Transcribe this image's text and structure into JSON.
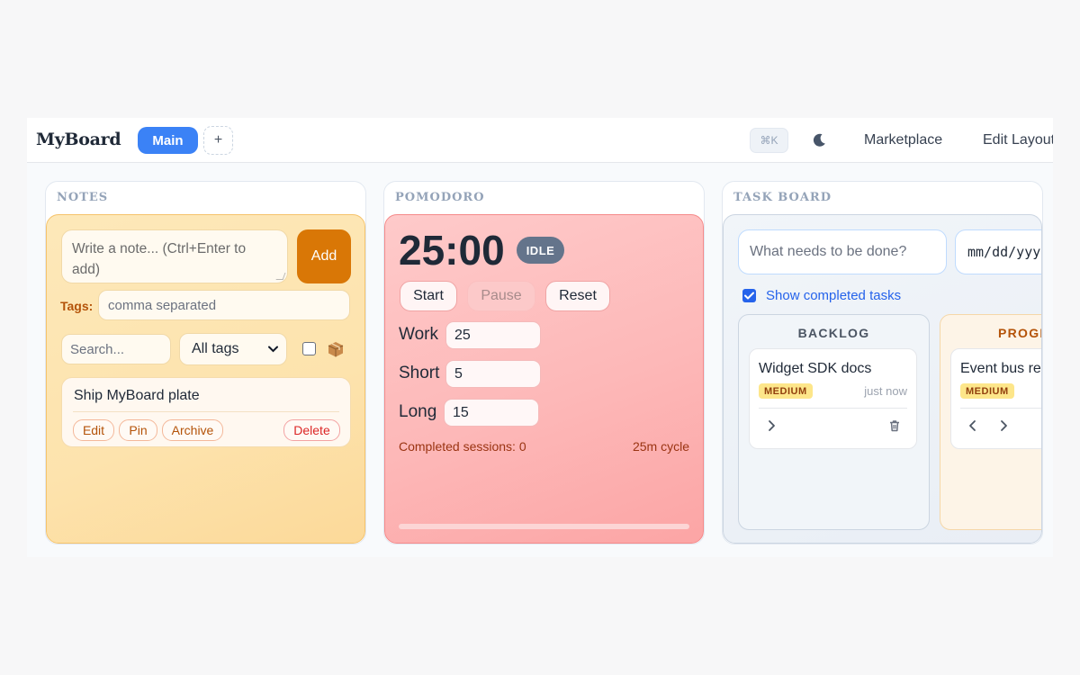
{
  "header": {
    "brand": "MyBoard",
    "tabs": [
      {
        "label": "Main",
        "active": true
      }
    ],
    "add_tab_label": "+",
    "shortcut_hint": "⌘K",
    "nav": {
      "marketplace": "Marketplace",
      "edit_layout": "Edit Layout"
    }
  },
  "notes": {
    "title": "NOTES",
    "note_placeholder": "Write a note... (Ctrl+Enter to add)",
    "add_label": "Add",
    "tags_label": "Tags:",
    "tags_placeholder": "comma separated",
    "search_placeholder": "Search...",
    "tag_filter_selected": "All tags",
    "archive_toggle_checked": false,
    "items": [
      {
        "title": "Ship MyBoard plate",
        "actions": {
          "edit": "Edit",
          "pin": "Pin",
          "archive": "Archive",
          "delete": "Delete"
        }
      }
    ]
  },
  "pomodoro": {
    "title": "POMODORO",
    "time": "25:00",
    "status": "IDLE",
    "buttons": {
      "start": "Start",
      "pause": "Pause",
      "reset": "Reset"
    },
    "work_label": "Work",
    "work_value": "25",
    "short_label": "Short",
    "short_value": "5",
    "long_label": "Long",
    "long_value": "15",
    "sessions_text": "Completed sessions: 0",
    "cycle_text": "25m cycle",
    "progress": 0
  },
  "taskboard": {
    "title": "TASK BOARD",
    "task_placeholder": "What needs to be done?",
    "date_placeholder": "mm/dd/yyyy",
    "show_completed_label": "Show completed tasks",
    "show_completed_checked": true,
    "columns": [
      {
        "title": "BACKLOG",
        "cards": [
          {
            "title": "Widget SDK docs",
            "priority": "MEDIUM",
            "time": "just now"
          }
        ]
      },
      {
        "title": "PROGRESS",
        "cards": [
          {
            "title": "Event bus refactor",
            "priority": "MEDIUM",
            "time": ""
          }
        ]
      }
    ]
  },
  "colors": {
    "accent": "#3b82f6",
    "notes_bg": "#fde3ad",
    "add_button": "#d97706",
    "pomodoro_bg": "#fdb8b8",
    "status_badge": "#64748b",
    "priority_badge": "#fde68a",
    "link": "#2563eb"
  },
  "icons": [
    "moon-icon",
    "chevron-down-icon",
    "box-icon",
    "chevron-right-icon",
    "chevron-left-icon",
    "trash-icon",
    "check-icon"
  ]
}
